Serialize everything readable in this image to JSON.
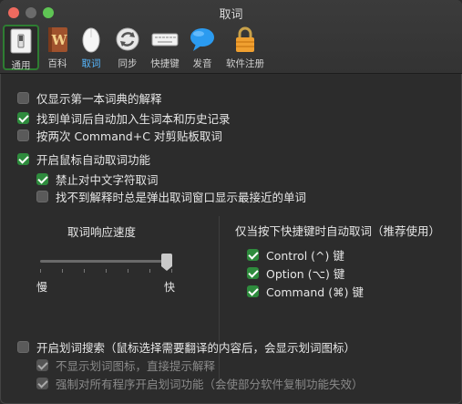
{
  "window": {
    "title": "取词"
  },
  "toolbar": {
    "items": [
      {
        "label": "通用",
        "icon": "switch-icon"
      },
      {
        "label": "百科",
        "icon": "wiki-book-icon"
      },
      {
        "label": "取词",
        "icon": "mouse-icon"
      },
      {
        "label": "同步",
        "icon": "sync-icon"
      },
      {
        "label": "快捷键",
        "icon": "keyboard-icon"
      },
      {
        "label": "发音",
        "icon": "speech-bubble-icon"
      },
      {
        "label": "软件注册",
        "icon": "lock-icon"
      }
    ]
  },
  "options": {
    "first_dict": {
      "label": "仅显示第一本词典的解释",
      "checked": false
    },
    "auto_add": {
      "label": "找到单词后自动加入生词本和历史记录",
      "checked": true
    },
    "double_copy": {
      "label": "按两次 Command+C 对剪贴板取词",
      "checked": false
    },
    "mouse_capture": {
      "label": "开启鼠标自动取词功能",
      "checked": true
    },
    "no_chinese": {
      "label": "禁止对中文字符取词",
      "checked": true
    },
    "show_nearest": {
      "label": "找不到解释时总是弹出取词窗口显示最接近的单词",
      "checked": false
    }
  },
  "speed": {
    "title": "取词响应速度",
    "min_label": "慢",
    "max_label": "快",
    "value": 1.0
  },
  "hotkey": {
    "title": "仅当按下快捷键时自动取词（推荐使用）",
    "control": {
      "label": "Control (^) 键",
      "checked": true
    },
    "option": {
      "label": "Option (⌥) 键",
      "checked": true
    },
    "command": {
      "label": "Command (⌘) 键",
      "checked": true
    }
  },
  "selection_search": {
    "label": "开启划词搜索（鼠标选择需要翻译的内容后，会显示划词图标）",
    "checked": false,
    "no_icon": {
      "label": "不显示划词图标，直接提示解释",
      "checked": true,
      "disabled": true
    },
    "force_all": {
      "label": "强制对所有程序开启划词功能（会使部分软件复制功能失效）",
      "checked": true,
      "disabled": true
    }
  }
}
